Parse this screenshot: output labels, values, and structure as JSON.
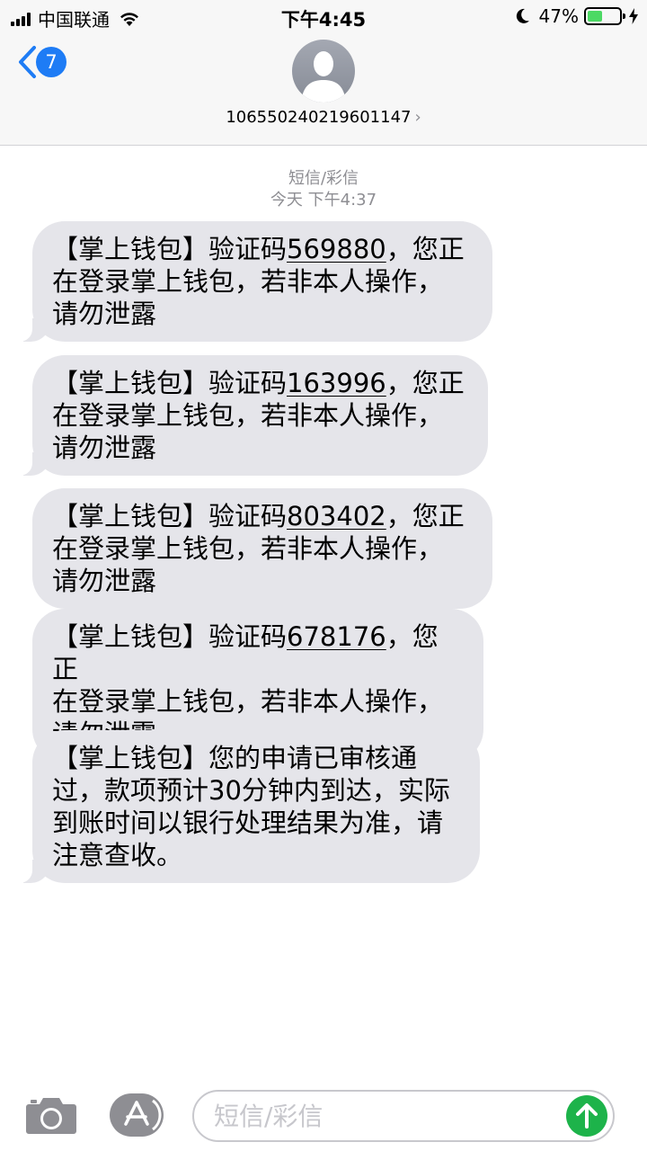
{
  "status_bar": {
    "carrier": "中国联通",
    "time": "下午4:45",
    "battery_percent": "47%",
    "battery_level": 0.47,
    "battery_color": "#4cd964"
  },
  "header": {
    "back_badge": "7",
    "contact_number": "106550240219601147",
    "chevron": "›"
  },
  "thread": {
    "type_label": "短信/彩信",
    "timestamp": "今天 下午4:37"
  },
  "messages": [
    {
      "prefix": "【掌上钱包】验证码",
      "code": "569880",
      "line1_rest": "，您正",
      "line2": "在登录掌上钱包，若非本人操作，",
      "line3": "请勿泄露"
    },
    {
      "prefix": "【掌上钱包】验证码",
      "code": "163996",
      "line1_rest": "，您正",
      "line2": "在登录掌上钱包，若非本人操作，",
      "line3": "请勿泄露"
    },
    {
      "prefix": "【掌上钱包】验证码",
      "code": "803402",
      "line1_rest": "，您正",
      "line2": "在登录掌上钱包，若非本人操作，",
      "line3": "请勿泄露"
    },
    {
      "prefix": "【掌上钱包】验证码",
      "code": "678176",
      "line1_rest": "，您正",
      "line2": "在登录掌上钱包，若非本人操作，",
      "line3": "请勿泄露"
    },
    {
      "lines": [
        "【掌上钱包】您的申请已审核通",
        "过，款项预计30分钟内到达，实际",
        "到账时间以银行处理结果为准，请",
        "注意查收。"
      ]
    }
  ],
  "composer": {
    "placeholder": "短信/彩信",
    "icons": [
      "camera-icon",
      "app-store-icon",
      "send-arrow-icon"
    ],
    "accent_color": "#1db34a"
  },
  "colors": {
    "bubble": "#e5e5ea",
    "badge": "#1e7cf5",
    "meta_text": "#8e8e93"
  }
}
